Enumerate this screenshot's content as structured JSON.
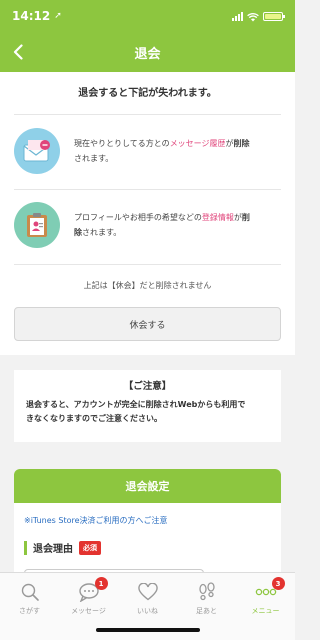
{
  "status_bar": {
    "time": "14:12",
    "location_glyph": "➚"
  },
  "nav": {
    "title": "退会"
  },
  "intro": {
    "lead": "退会すると下記が失われます。"
  },
  "loss_items": [
    {
      "icon": "envelope-icon",
      "line1_pre": "現在やりとりしてる方との",
      "line1_hl": "メッセージ履歴",
      "line1_post": "が",
      "line1_bold": "削除",
      "line2": "されます。"
    },
    {
      "icon": "clipboard-profile-icon",
      "line1_pre": "プロフィールやお相手の希望などの",
      "line1_hl": "登録情報",
      "line1_post": "が",
      "line1_bold": "削",
      "line2_bold": "除",
      "line2": "されます。"
    }
  ],
  "pause": {
    "note": "上記は【休会】だと削除されません",
    "button_label": "休会する"
  },
  "caution": {
    "heading": "【ご注意】",
    "line1": "退会すると、アカウントが完全に削除されWebからも利用で",
    "line2": "きなくなりますのでご注意ください。"
  },
  "settings": {
    "header": "退会設定",
    "itunes_link": "※iTunes Store決済ご利用の方へご注意",
    "reason_label": "退会理由",
    "required_badge": "必須"
  },
  "tabs": [
    {
      "label": "さがす",
      "icon": "search-icon",
      "badge": ""
    },
    {
      "label": "メッセージ",
      "icon": "chat-icon",
      "badge": "1"
    },
    {
      "label": "いいね",
      "icon": "heart-icon",
      "badge": ""
    },
    {
      "label": "足あと",
      "icon": "footprints-icon",
      "badge": ""
    },
    {
      "label": "メニュー",
      "icon": "menu-icon",
      "badge": "3"
    }
  ],
  "colors": {
    "brand_green": "#8dc63f",
    "highlight_pink": "#e0457b",
    "badge_red": "#e3332f",
    "link_blue": "#2a6ec1"
  }
}
